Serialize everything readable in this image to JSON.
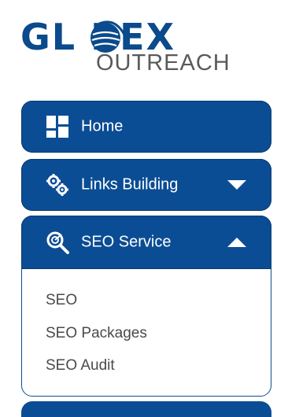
{
  "logo": {
    "main": "GL BEX",
    "sub": "OUTREACH"
  },
  "menu": {
    "home": {
      "label": "Home",
      "icon": "dashboard-icon"
    },
    "links_building": {
      "label": "Links Building",
      "icon": "gears-icon"
    },
    "seo_service": {
      "label": "SEO Service",
      "icon": "seo-search-icon",
      "items": [
        "SEO",
        "SEO Packages",
        "SEO Audit"
      ]
    }
  },
  "colors": {
    "primary": "#0b4d94",
    "logo_blue": "#0b4a8c",
    "text_gray": "#4a4a4a"
  }
}
